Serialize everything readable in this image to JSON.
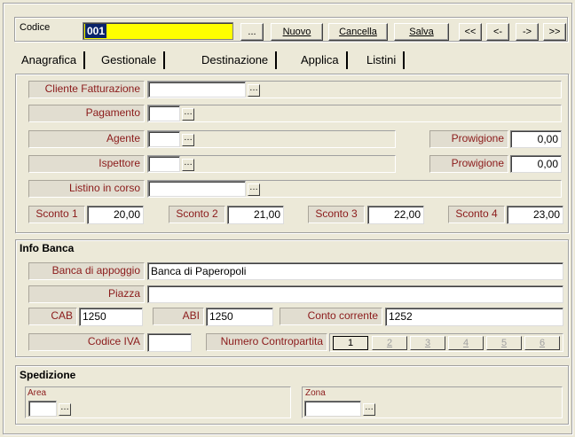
{
  "header": {
    "codice_label": "Codice",
    "codice_value": "001",
    "dots": "...",
    "nuovo": "Nuovo",
    "cancella": "Cancella",
    "salva": "Salva",
    "nav_first": "<<",
    "nav_prev": "<-",
    "nav_next": "->",
    "nav_last": ">>"
  },
  "tabs": [
    {
      "label": "Anagrafica"
    },
    {
      "label": "Gestionale"
    },
    {
      "label": "Destinazione"
    },
    {
      "label": "Applica"
    },
    {
      "label": "Listini"
    }
  ],
  "gestionale": {
    "cliente_fatturazione": "Cliente Fatturazione",
    "pagamento": "Pagamento",
    "agente": "Agente",
    "ispettore": "Ispettore",
    "provvigione_label": "Prowigione",
    "provvigione_agente": "0,00",
    "provvigione_ispettore": "0,00",
    "listino_in_corso": "Listino in corso",
    "sconto1_label": "Sconto 1",
    "sconto1": "20,00",
    "sconto2_label": "Sconto 2",
    "sconto2": "21,00",
    "sconto3_label": "Sconto 3",
    "sconto3": "22,00",
    "sconto4_label": "Sconto 4",
    "sconto4": "23,00"
  },
  "banca": {
    "title": "Info Banca",
    "banca_label": "Banca di appoggio",
    "banca_value": "Banca di Paperopoli",
    "piazza_label": "Piazza",
    "piazza_value": "",
    "cab_label": "CAB",
    "cab_value": "1250",
    "abi_label": "ABI",
    "abi_value": "1250",
    "conto_label": "Conto corrente",
    "conto_value": "1252",
    "codice_iva_label": "Codice IVA",
    "codice_iva_value": "",
    "contropartita_label": "Numero Contropartita",
    "pages": [
      "1",
      "2",
      "3",
      "4",
      "5",
      "6"
    ]
  },
  "spedizione": {
    "title": "Spedizione",
    "area_label": "Area",
    "zona_label": "Zona"
  },
  "colors": {
    "background": "#ece9d8",
    "label_text": "#8b1a1a",
    "codice_highlight": "#ffff00",
    "codice_selection": "#0a246a"
  }
}
